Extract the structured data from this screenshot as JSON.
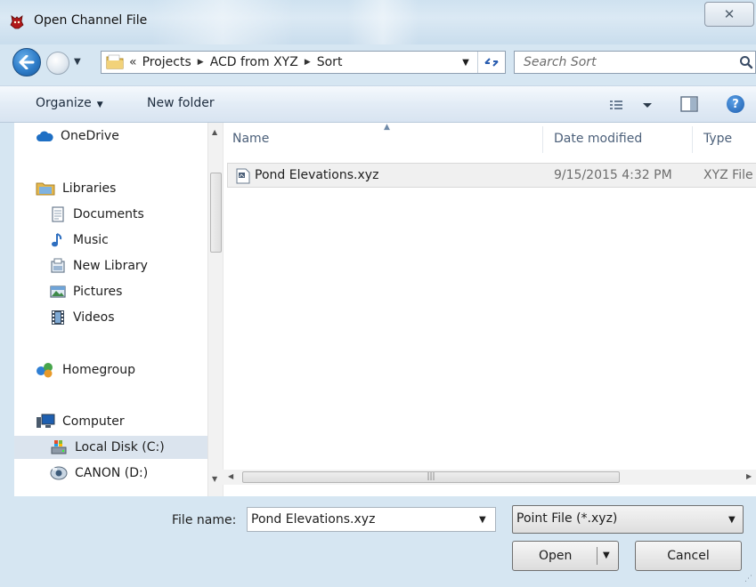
{
  "window": {
    "title": "Open Channel File",
    "close_glyph": "✕"
  },
  "navigation": {
    "overflow": "«",
    "breadcrumbs": [
      "Projects",
      "ACD from XYZ",
      "Sort"
    ],
    "search_placeholder": "Search Sort"
  },
  "toolbar": {
    "organize_label": "Organize",
    "new_folder_label": "New folder",
    "help_glyph": "?"
  },
  "nav_pane": {
    "items": [
      {
        "label": "OneDrive",
        "icon": "cloud-icon"
      },
      {
        "label": "Libraries",
        "icon": "libraries-folder-icon"
      },
      {
        "label": "Documents",
        "icon": "document-icon"
      },
      {
        "label": "Music",
        "icon": "music-note-icon"
      },
      {
        "label": "New Library",
        "icon": "library-icon"
      },
      {
        "label": "Pictures",
        "icon": "picture-icon"
      },
      {
        "label": "Videos",
        "icon": "film-icon"
      },
      {
        "label": "Homegroup",
        "icon": "homegroup-icon"
      },
      {
        "label": "Computer",
        "icon": "computer-icon"
      },
      {
        "label": "Local Disk (C:)",
        "icon": "hard-drive-icon",
        "selected": true
      },
      {
        "label": "CANON (D:)",
        "icon": "camera-drive-icon"
      }
    ]
  },
  "file_list": {
    "columns": [
      "Name",
      "Date modified",
      "Type"
    ],
    "rows": [
      {
        "name": "Pond Elevations.xyz",
        "date_modified": "9/15/2015 4:32 PM",
        "type": "XYZ File"
      }
    ]
  },
  "footer": {
    "file_name_label": "File name:",
    "file_name_value": "Pond Elevations.xyz",
    "file_type_value": "Point File (*.xyz)",
    "open_label": "Open",
    "cancel_label": "Cancel"
  },
  "colors": {
    "accent": "#2e7cc8",
    "selection": "#dbe4ee",
    "header_text": "#4c607a"
  }
}
